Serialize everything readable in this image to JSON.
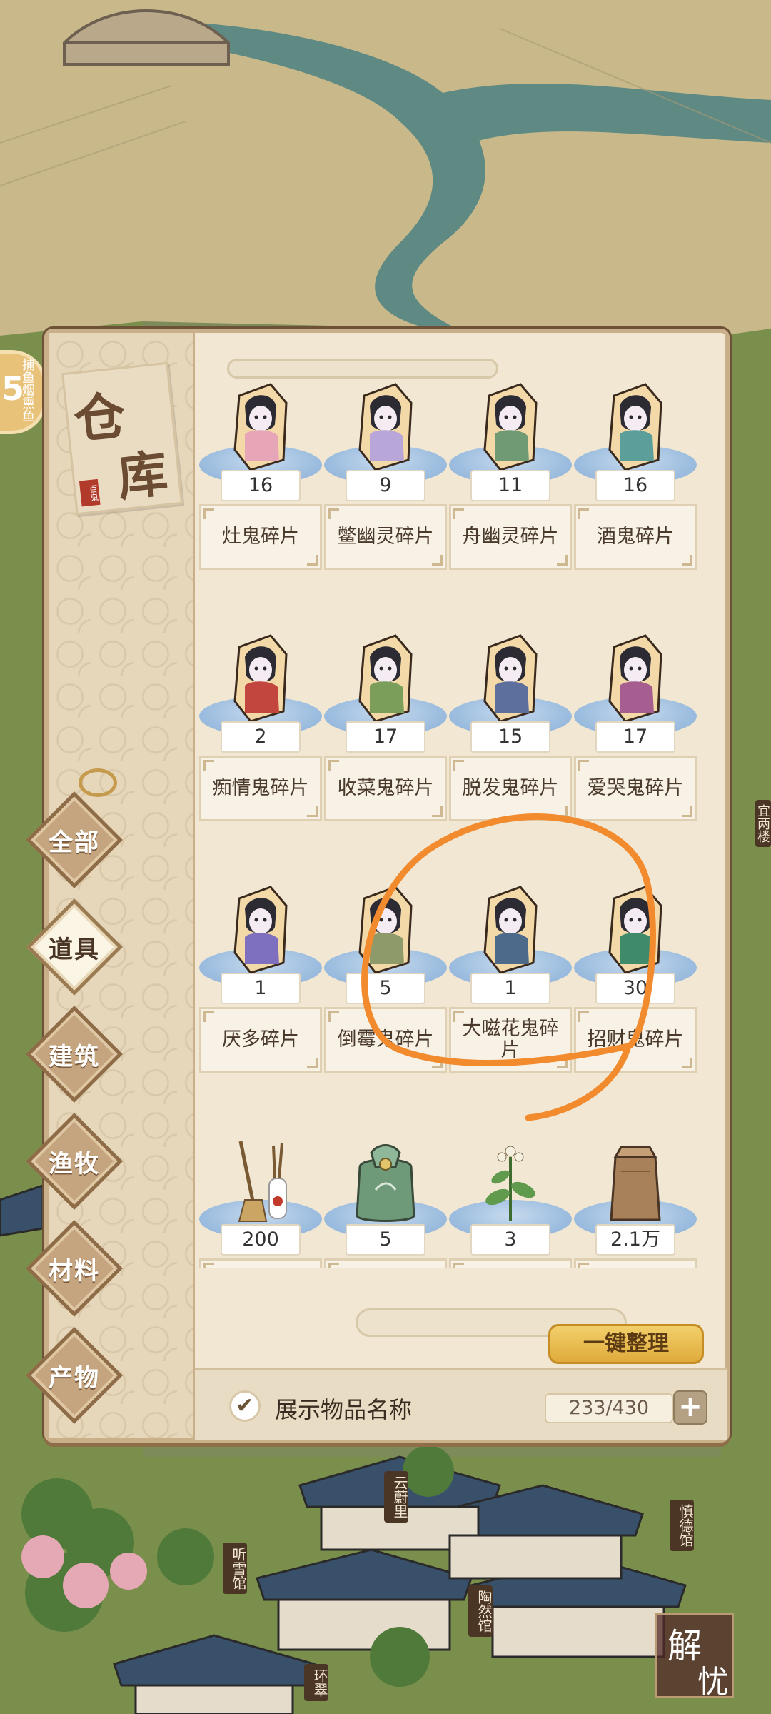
{
  "side_badge": {
    "number": "5",
    "text": "捕鱼烟熏鱼"
  },
  "warehouse": {
    "title_chars": [
      "仓",
      "库"
    ],
    "seal_text": "百鬼",
    "tabs": [
      {
        "label": "全部",
        "active": false
      },
      {
        "label": "道具",
        "active": true
      },
      {
        "label": "建筑",
        "active": false
      },
      {
        "label": "渔牧",
        "active": false
      },
      {
        "label": "材料",
        "active": false
      },
      {
        "label": "产物",
        "active": false
      }
    ],
    "items": [
      {
        "name": "灶鬼碎片",
        "count": "16",
        "icon": "ghost-fragment-icon",
        "color": "#e7a6b7"
      },
      {
        "name": "鳖幽灵碎片",
        "count": "9",
        "icon": "ghost-fragment-icon",
        "color": "#b8a6d8"
      },
      {
        "name": "舟幽灵碎片",
        "count": "11",
        "icon": "ghost-fragment-icon",
        "color": "#6f9a73"
      },
      {
        "name": "酒鬼碎片",
        "count": "16",
        "icon": "ghost-fragment-icon",
        "color": "#5c9f9a"
      },
      {
        "name": "痴情鬼碎片",
        "count": "2",
        "icon": "ghost-fragment-icon",
        "color": "#c2463d"
      },
      {
        "name": "收菜鬼碎片",
        "count": "17",
        "icon": "ghost-fragment-icon",
        "color": "#7b9f5b"
      },
      {
        "name": "脱发鬼碎片",
        "count": "15",
        "icon": "ghost-fragment-icon",
        "color": "#5d6f9c"
      },
      {
        "name": "爱哭鬼碎片",
        "count": "17",
        "icon": "ghost-fragment-icon",
        "color": "#a65d8f"
      },
      {
        "name": "厌多碎片",
        "count": "1",
        "icon": "ghost-fragment-icon",
        "color": "#7f6fbf"
      },
      {
        "name": "倒霉鬼碎片",
        "count": "5",
        "icon": "ghost-fragment-icon",
        "color": "#8e9a6a"
      },
      {
        "name": "大嗞花鬼碎片",
        "count": "1",
        "icon": "ghost-fragment-icon",
        "color": "#4d6a8a"
      },
      {
        "name": "招财鬼碎片",
        "count": "30",
        "icon": "ghost-fragment-icon",
        "color": "#3f8a6b"
      },
      {
        "name": "扫把",
        "count": "200",
        "icon": "broom-icon",
        "color": "#9c7a4a"
      },
      {
        "name": "中级礼物",
        "count": "5",
        "icon": "gift-bag-icon",
        "color": "#6e9a7a"
      },
      {
        "name": "水莽草",
        "count": "3",
        "icon": "herb-icon",
        "color": "#5f9a4d"
      },
      {
        "name": "饲料",
        "count": "2.1万",
        "icon": "feed-bag-icon",
        "color": "#a8805a"
      }
    ],
    "sort_button": "一键整理",
    "show_names_label": "展示物品名称",
    "show_names_checked": true,
    "capacity": "233/430",
    "expand_symbol": "+"
  },
  "town_labels": [
    "云蔚里",
    "慎德馆",
    "听雪馆",
    "陶然馆",
    "环翠"
  ],
  "map_labels_right": [
    "宜两楼"
  ],
  "corner_stamp": [
    "解",
    "忧"
  ],
  "colors": {
    "annotation": "#f28a2e",
    "panel": "#f1e7d3",
    "accent": "#e0ab3c"
  }
}
